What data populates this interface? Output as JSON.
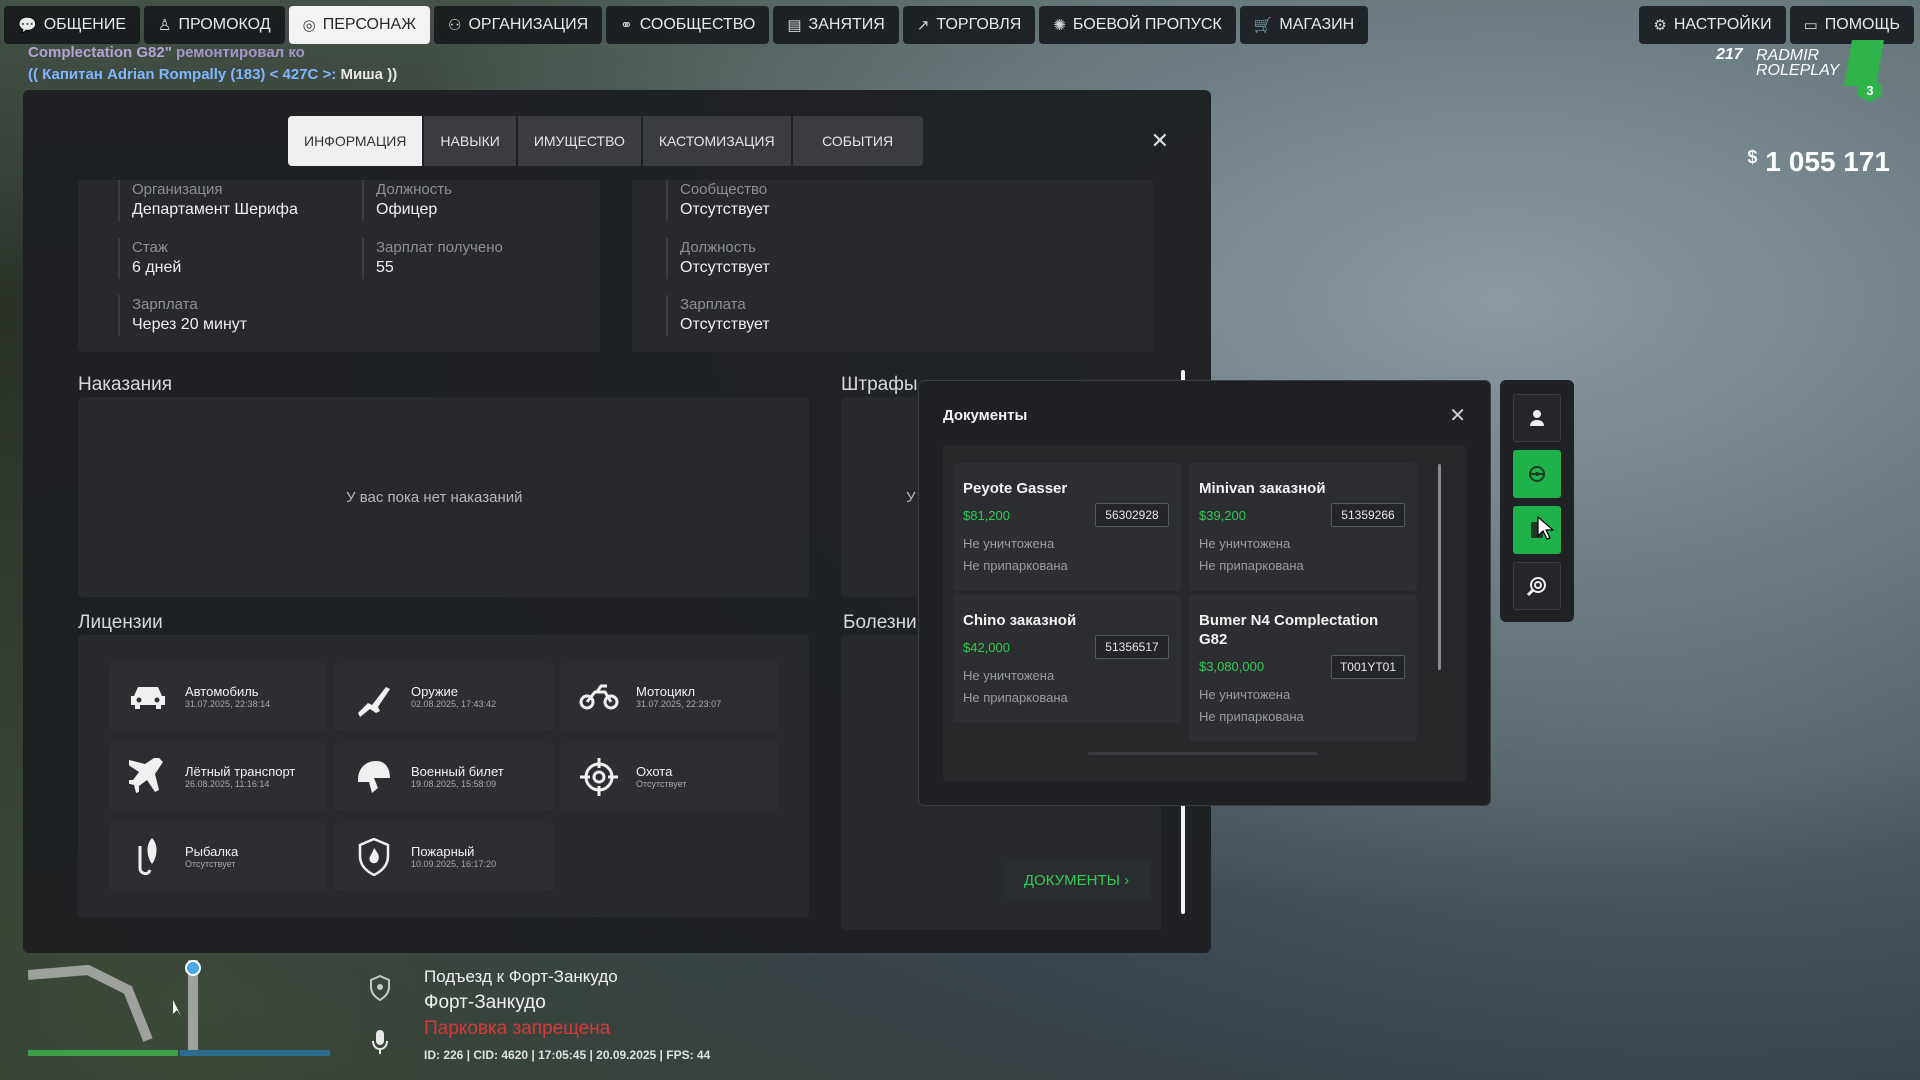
{
  "topbar": {
    "left": [
      {
        "label": "ОБЩЕНИЕ",
        "icon": "chat-icon"
      },
      {
        "label": "ПРОМОКОД",
        "icon": "person-icon"
      },
      {
        "label": "ПЕРСОНАЖ",
        "icon": "user-icon",
        "active": true
      },
      {
        "label": "ОРГАНИЗАЦИЯ",
        "icon": "org-icon"
      },
      {
        "label": "СООБЩЕСТВО",
        "icon": "community-icon"
      },
      {
        "label": "ЗАНЯТИЯ",
        "icon": "clipboard-icon"
      },
      {
        "label": "ТОРГОВЛЯ",
        "icon": "chart-icon"
      },
      {
        "label": "БОЕВОЙ ПРОПУСК",
        "icon": "gear-badge-icon"
      },
      {
        "label": "МАГАЗИН",
        "icon": "cart-icon"
      }
    ],
    "right": [
      {
        "label": "НАСТРОЙКИ",
        "icon": "gear-icon"
      },
      {
        "label": "ПОМОЩЬ",
        "icon": "help-icon"
      }
    ]
  },
  "chat": {
    "line1": "Complectation G82\"",
    "line1_tail": "ремонтировал ко",
    "line2_prefix": "(( Капитан Adrian Rompally (183) < 427C >:",
    "line2_msg": " Миша ))"
  },
  "logo": {
    "level": "217",
    "brand_top": "RADMIR",
    "brand_bottom": "ROLEPLAY",
    "badge": "3"
  },
  "money": {
    "currency": "$",
    "amount": "1 055 171"
  },
  "tabs": [
    "ИНФОРМАЦИЯ",
    "НАВЫКИ",
    "ИМУЩЕСТВО",
    "КАСТОМИЗАЦИЯ",
    "СОБЫТИЯ"
  ],
  "org_card": {
    "fields": [
      {
        "label": "Организация",
        "value": "Департамент Шерифа"
      },
      {
        "label": "Должность",
        "value": "Офицер"
      },
      {
        "label": "Стаж",
        "value": "6 дней"
      },
      {
        "label": "Зарплат получено",
        "value": "55"
      },
      {
        "label": "Зарплата",
        "value": "Через 20 минут"
      }
    ]
  },
  "community_card": {
    "fields": [
      {
        "label": "Сообщество",
        "value": "Отсутствует"
      },
      {
        "label": "Должность",
        "value": "Отсутствует"
      },
      {
        "label": "Зарплата",
        "value": "Отсутствует"
      }
    ]
  },
  "punishments": {
    "title": "Наказания",
    "empty": "У вас пока нет наказаний"
  },
  "fines": {
    "title": "Штрафы",
    "empty_partial": "У"
  },
  "diseases": {
    "title": "Болезни"
  },
  "licenses": {
    "title": "Лицензии",
    "items": [
      {
        "name": "Автомобиль",
        "date": "31.07.2025, 22:38:14",
        "icon": "car-icon"
      },
      {
        "name": "Оружие",
        "date": "02.08.2025, 17:43:42",
        "icon": "rifle-icon"
      },
      {
        "name": "Мотоцикл",
        "date": "31.07.2025, 22:23:07",
        "icon": "motorcycle-icon"
      },
      {
        "name": "Лётный транспорт",
        "date": "26.08.2025, 11:16:14",
        "icon": "plane-icon"
      },
      {
        "name": "Военный билет",
        "date": "19.08.2025, 15:58:09",
        "icon": "helmet-icon"
      },
      {
        "name": "Охота",
        "date": "Отсутствует",
        "icon": "crosshair-icon"
      },
      {
        "name": "Рыбалка",
        "date": "Отсутствует",
        "icon": "fish-icon"
      },
      {
        "name": "Пожарный",
        "date": "10.09.2025, 16:17:20",
        "icon": "fire-shield-icon"
      }
    ]
  },
  "docs_link": {
    "label": "ДОКУМЕНТЫ",
    "icon": "chevron-right-icon"
  },
  "documents": {
    "title": "Документы",
    "vehicles": [
      {
        "name": "Peyote Gasser",
        "price": "$81,200",
        "plate": "56302928",
        "status1": "Не уничтожена",
        "status2": "Не припаркована"
      },
      {
        "name": "Minivan заказной",
        "price": "$39,200",
        "plate": "51359266",
        "status1": "Не уничтожена",
        "status2": "Не припаркована"
      },
      {
        "name": "Chino заказной",
        "price": "$42,000",
        "plate": "51356517",
        "status1": "Не уничтожена",
        "status2": "Не припаркована"
      },
      {
        "name": "Bumer N4 Complectation G82",
        "price": "$3,080,000",
        "plate": "T001YT01",
        "status1": "Не уничтожена",
        "status2": "Не припаркована"
      }
    ]
  },
  "side_buttons": [
    "person-icon",
    "steering-wheel-icon",
    "document-icon",
    "search-gear-icon"
  ],
  "hud": {
    "road": "Подъезд к Форт-Занкудо",
    "zone": "Форт-Занкудо",
    "warning": "Парковка запрещена",
    "info": "ID: 226 | CID: 4620 | 17:05:45 | 20.09.2025 | FPS: 44"
  }
}
